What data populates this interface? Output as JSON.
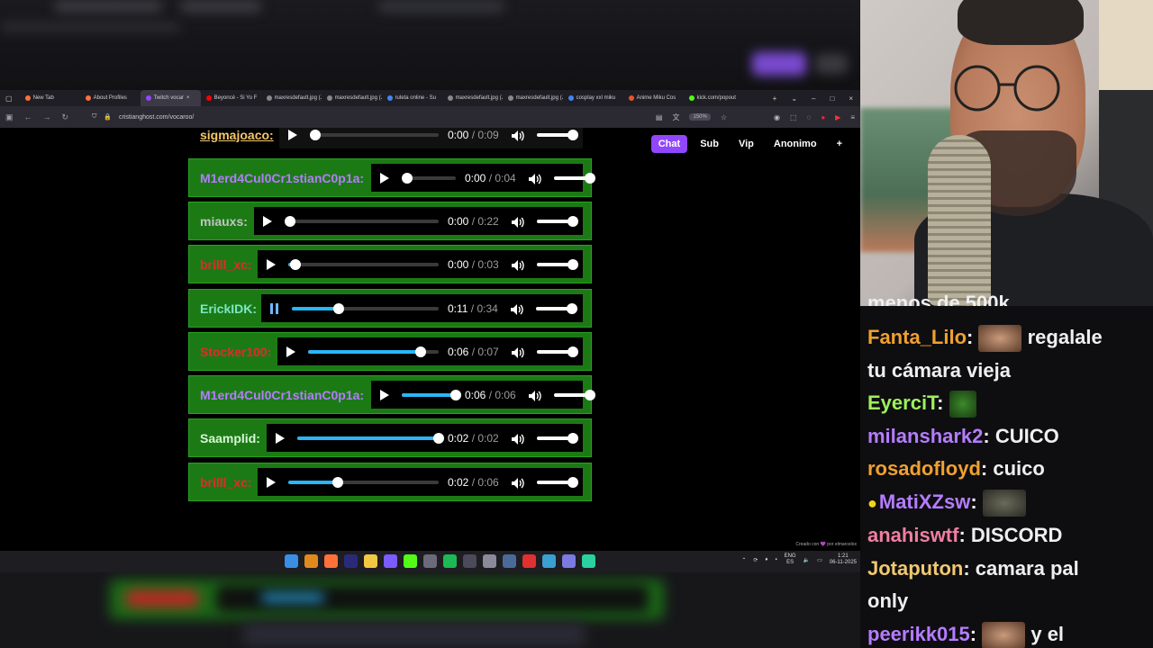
{
  "browser": {
    "tabs": [
      {
        "label": "New Tab",
        "color": "#ff7139",
        "active": false
      },
      {
        "label": "About Profiles",
        "color": "#ff7139",
        "active": false
      },
      {
        "label": "Twitch vocar",
        "color": "#9147ff",
        "active": true
      },
      {
        "label": "Beyoncé - Si Yo F",
        "color": "#ff0000",
        "active": false
      },
      {
        "label": "maxresdefault.jpg (JP",
        "color": "#888888",
        "active": false
      },
      {
        "label": "maxresdefault.jpg (JP",
        "color": "#888888",
        "active": false
      },
      {
        "label": "ruleta online - Su",
        "color": "#4285f4",
        "active": false
      },
      {
        "label": "maxresdefault.jpg (JP",
        "color": "#888888",
        "active": false
      },
      {
        "label": "maxresdefault.jpg (JP",
        "color": "#888888",
        "active": false
      },
      {
        "label": "cosplay xxl miku",
        "color": "#4285f4",
        "active": false
      },
      {
        "label": "Anime Miku Cos",
        "color": "#e8542d",
        "active": false
      },
      {
        "label": "kick.com/popout",
        "color": "#53fc18",
        "active": false
      }
    ],
    "url": "cristianghost.com/vocaroo/",
    "zoom": "150%"
  },
  "page": {
    "mode_tabs": [
      "Chat",
      "Sub",
      "Vip",
      "Anonimo",
      "+"
    ],
    "active_mode": "Chat",
    "credit": "Creado con 💜 por elmarcelox",
    "rows": [
      {
        "user": "sigmajoaco:",
        "user_color": "#f4c86b",
        "state": "play",
        "progress": 0.0,
        "current": "0:00",
        "duration": "0:09",
        "style": "first"
      },
      {
        "user": "M1erd4Cul0Cr1stianC0p1a:",
        "user_color": "#b57cff",
        "state": "play",
        "progress": 0.0,
        "current": "0:00",
        "duration": "0:04",
        "style": "green"
      },
      {
        "user": "miauxs:",
        "user_color": "#c3c3c3",
        "state": "play",
        "progress": 0.0,
        "current": "0:00",
        "duration": "0:22",
        "style": "green"
      },
      {
        "user": "brilll_xc:",
        "user_color": "#e22a2a",
        "state": "play",
        "progress": 0.05,
        "current": "0:00",
        "duration": "0:03",
        "style": "green"
      },
      {
        "user": "ErickIDK:",
        "user_color": "#7de6c5",
        "state": "pause",
        "progress": 0.32,
        "current": "0:11",
        "duration": "0:34",
        "style": "green"
      },
      {
        "user": "Stocker100:",
        "user_color": "#e22a2a",
        "state": "play",
        "progress": 0.86,
        "current": "0:06",
        "duration": "0:07",
        "style": "green"
      },
      {
        "user": "M1erd4Cul0Cr1stianC0p1a:",
        "user_color": "#b57cff",
        "state": "play",
        "progress": 1.0,
        "current": "0:06",
        "duration": "0:06",
        "style": "green"
      },
      {
        "user": "Saamplid:",
        "user_color": "#d7f7d7",
        "state": "play",
        "progress": 1.0,
        "current": "0:02",
        "duration": "0:02",
        "style": "green"
      },
      {
        "user": "brilll_xc:",
        "user_color": "#e22a2a",
        "state": "play",
        "progress": 0.33,
        "current": "0:02",
        "duration": "0:06",
        "style": "green"
      }
    ]
  },
  "taskbar": {
    "lang": "ENG",
    "region": "ES",
    "time": "1:21",
    "date": "06-11-2025",
    "icons": [
      "windows-icon",
      "search-icon",
      "firefox-icon",
      "premiere-icon",
      "explorer-icon",
      "obs-icon",
      "kick-icon",
      "app-icon",
      "spotify-icon",
      "app2-icon",
      "settings-icon",
      "app3-icon",
      "app4-icon",
      "app5-icon",
      "app6-icon",
      "app7-icon"
    ]
  },
  "chat": {
    "partial_line": "menos de 500k",
    "messages": [
      {
        "name": "Fanta_Lilo",
        "color": "#f0a030",
        "emote": "face",
        "text": "regalale"
      },
      {
        "name": "",
        "color": "#efeff1",
        "emote": "",
        "text": "tu cámara vieja"
      },
      {
        "name": "EyerciT",
        "color": "#9ef05c",
        "emote": "leaf",
        "text": ""
      },
      {
        "name": "milanshark2",
        "color": "#b57cff",
        "emote": "",
        "text": "CUICO"
      },
      {
        "name": "rosadofloyd",
        "color": "#f0a030",
        "emote": "",
        "text": "cuico"
      },
      {
        "name": "MatiXZsw",
        "color": "#b57cff",
        "emote": "cat",
        "text": "",
        "badge": "duck"
      },
      {
        "name": "anahiswtf",
        "color": "#f07ea0",
        "emote": "",
        "text": "DISCORD"
      },
      {
        "name": "Jotaputon",
        "color": "#f0c872",
        "emote": "",
        "text": "camara pal"
      },
      {
        "name": "",
        "color": "#efeff1",
        "emote": "",
        "text": "only"
      },
      {
        "name": "peerikk015",
        "color": "#b57cff",
        "emote": "face",
        "text": "y el"
      }
    ]
  }
}
